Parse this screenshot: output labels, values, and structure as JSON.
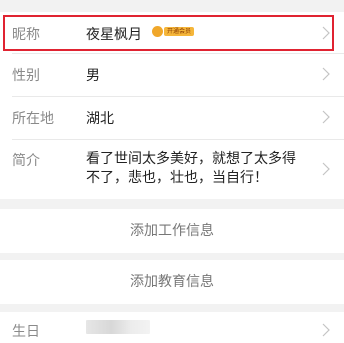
{
  "profile": {
    "nickname": {
      "label": "昵称",
      "value": "夜星枫月",
      "badge": "开通会员"
    },
    "gender": {
      "label": "性别",
      "value": "男"
    },
    "location": {
      "label": "所在地",
      "value": "湖北"
    },
    "intro": {
      "label": "简介",
      "value": "看了世间太多美好，就想了太多得不了，悲也，壮也，当自行！"
    },
    "birthday": {
      "label": "生日"
    }
  },
  "actions": {
    "add_work": "添加工作信息",
    "add_education": "添加教育信息"
  },
  "colors": {
    "highlight": "#e02331",
    "vip": "#f5b63a"
  }
}
